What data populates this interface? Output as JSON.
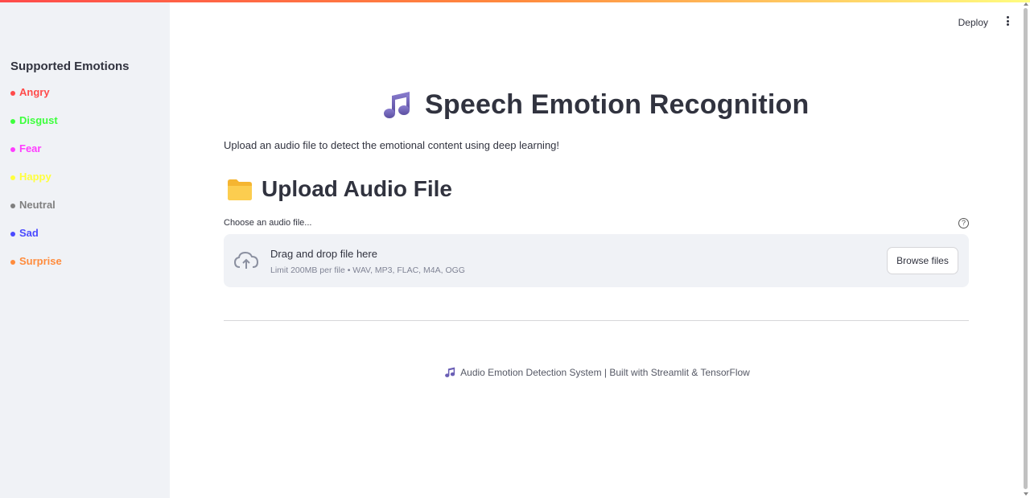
{
  "header": {
    "deploy_label": "Deploy"
  },
  "sidebar": {
    "title": "Supported Emotions",
    "emotions": [
      {
        "label": "Angry",
        "color": "#ff4b4b"
      },
      {
        "label": "Disgust",
        "color": "#3dff3d"
      },
      {
        "label": "Fear",
        "color": "#ff3dff"
      },
      {
        "label": "Happy",
        "color": "#ffff3d"
      },
      {
        "label": "Neutral",
        "color": "#808080"
      },
      {
        "label": "Sad",
        "color": "#4b4bff"
      },
      {
        "label": "Surprise",
        "color": "#ff8c3d"
      }
    ]
  },
  "main": {
    "title": "Speech Emotion Recognition",
    "title_icon": "musical-notes-icon",
    "subtitle": "Upload an audio file to detect the emotional content using deep learning!",
    "section_title": "Upload Audio File",
    "section_icon": "folder-icon",
    "uploader": {
      "label": "Choose an audio file...",
      "drop_text": "Drag and drop file here",
      "limit_text": "Limit 200MB per file • WAV, MP3, FLAC, M4A, OGG",
      "browse_label": "Browse files"
    },
    "footer": "Audio Emotion Detection System | Built with Streamlit & TensorFlow"
  },
  "colors": {
    "sidebar_bg": "#f0f2f6",
    "text": "#31333f",
    "accent_gradient": [
      "#ff4b4b",
      "#fffd80"
    ]
  }
}
